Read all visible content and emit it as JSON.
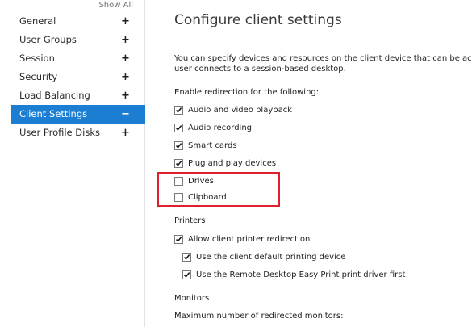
{
  "sidebar": {
    "show_all": "Show All",
    "items": [
      {
        "label": "General",
        "sign": "+"
      },
      {
        "label": "User Groups",
        "sign": "+"
      },
      {
        "label": "Session",
        "sign": "+"
      },
      {
        "label": "Security",
        "sign": "+"
      },
      {
        "label": "Load Balancing",
        "sign": "+"
      },
      {
        "label": "Client Settings",
        "sign": "−"
      },
      {
        "label": "User Profile Disks",
        "sign": "+"
      }
    ]
  },
  "main": {
    "title": "Configure client settings",
    "description_line1": "You can specify devices and resources on the client device that can be ac",
    "description_line2": "user connects to a session-based desktop.",
    "redirection_label": "Enable redirection for the following:",
    "redirection": [
      {
        "label": "Audio and video playback",
        "checked": true
      },
      {
        "label": "Audio recording",
        "checked": true
      },
      {
        "label": "Smart cards",
        "checked": true
      },
      {
        "label": "Plug and play devices",
        "checked": true
      },
      {
        "label": "Drives",
        "checked": false
      },
      {
        "label": "Clipboard",
        "checked": false
      }
    ],
    "printers_label": "Printers",
    "printers": [
      {
        "label": "Allow client printer redirection",
        "checked": true
      },
      {
        "label": "Use the client default printing device",
        "checked": true
      },
      {
        "label": "Use the Remote Desktop Easy Print print driver first",
        "checked": true
      }
    ],
    "monitors_label": "Monitors",
    "monitors_sub_label": "Maximum number of redirected monitors:"
  },
  "colors": {
    "accent": "#1b7ed3",
    "highlight_border": "#e01f2c"
  }
}
